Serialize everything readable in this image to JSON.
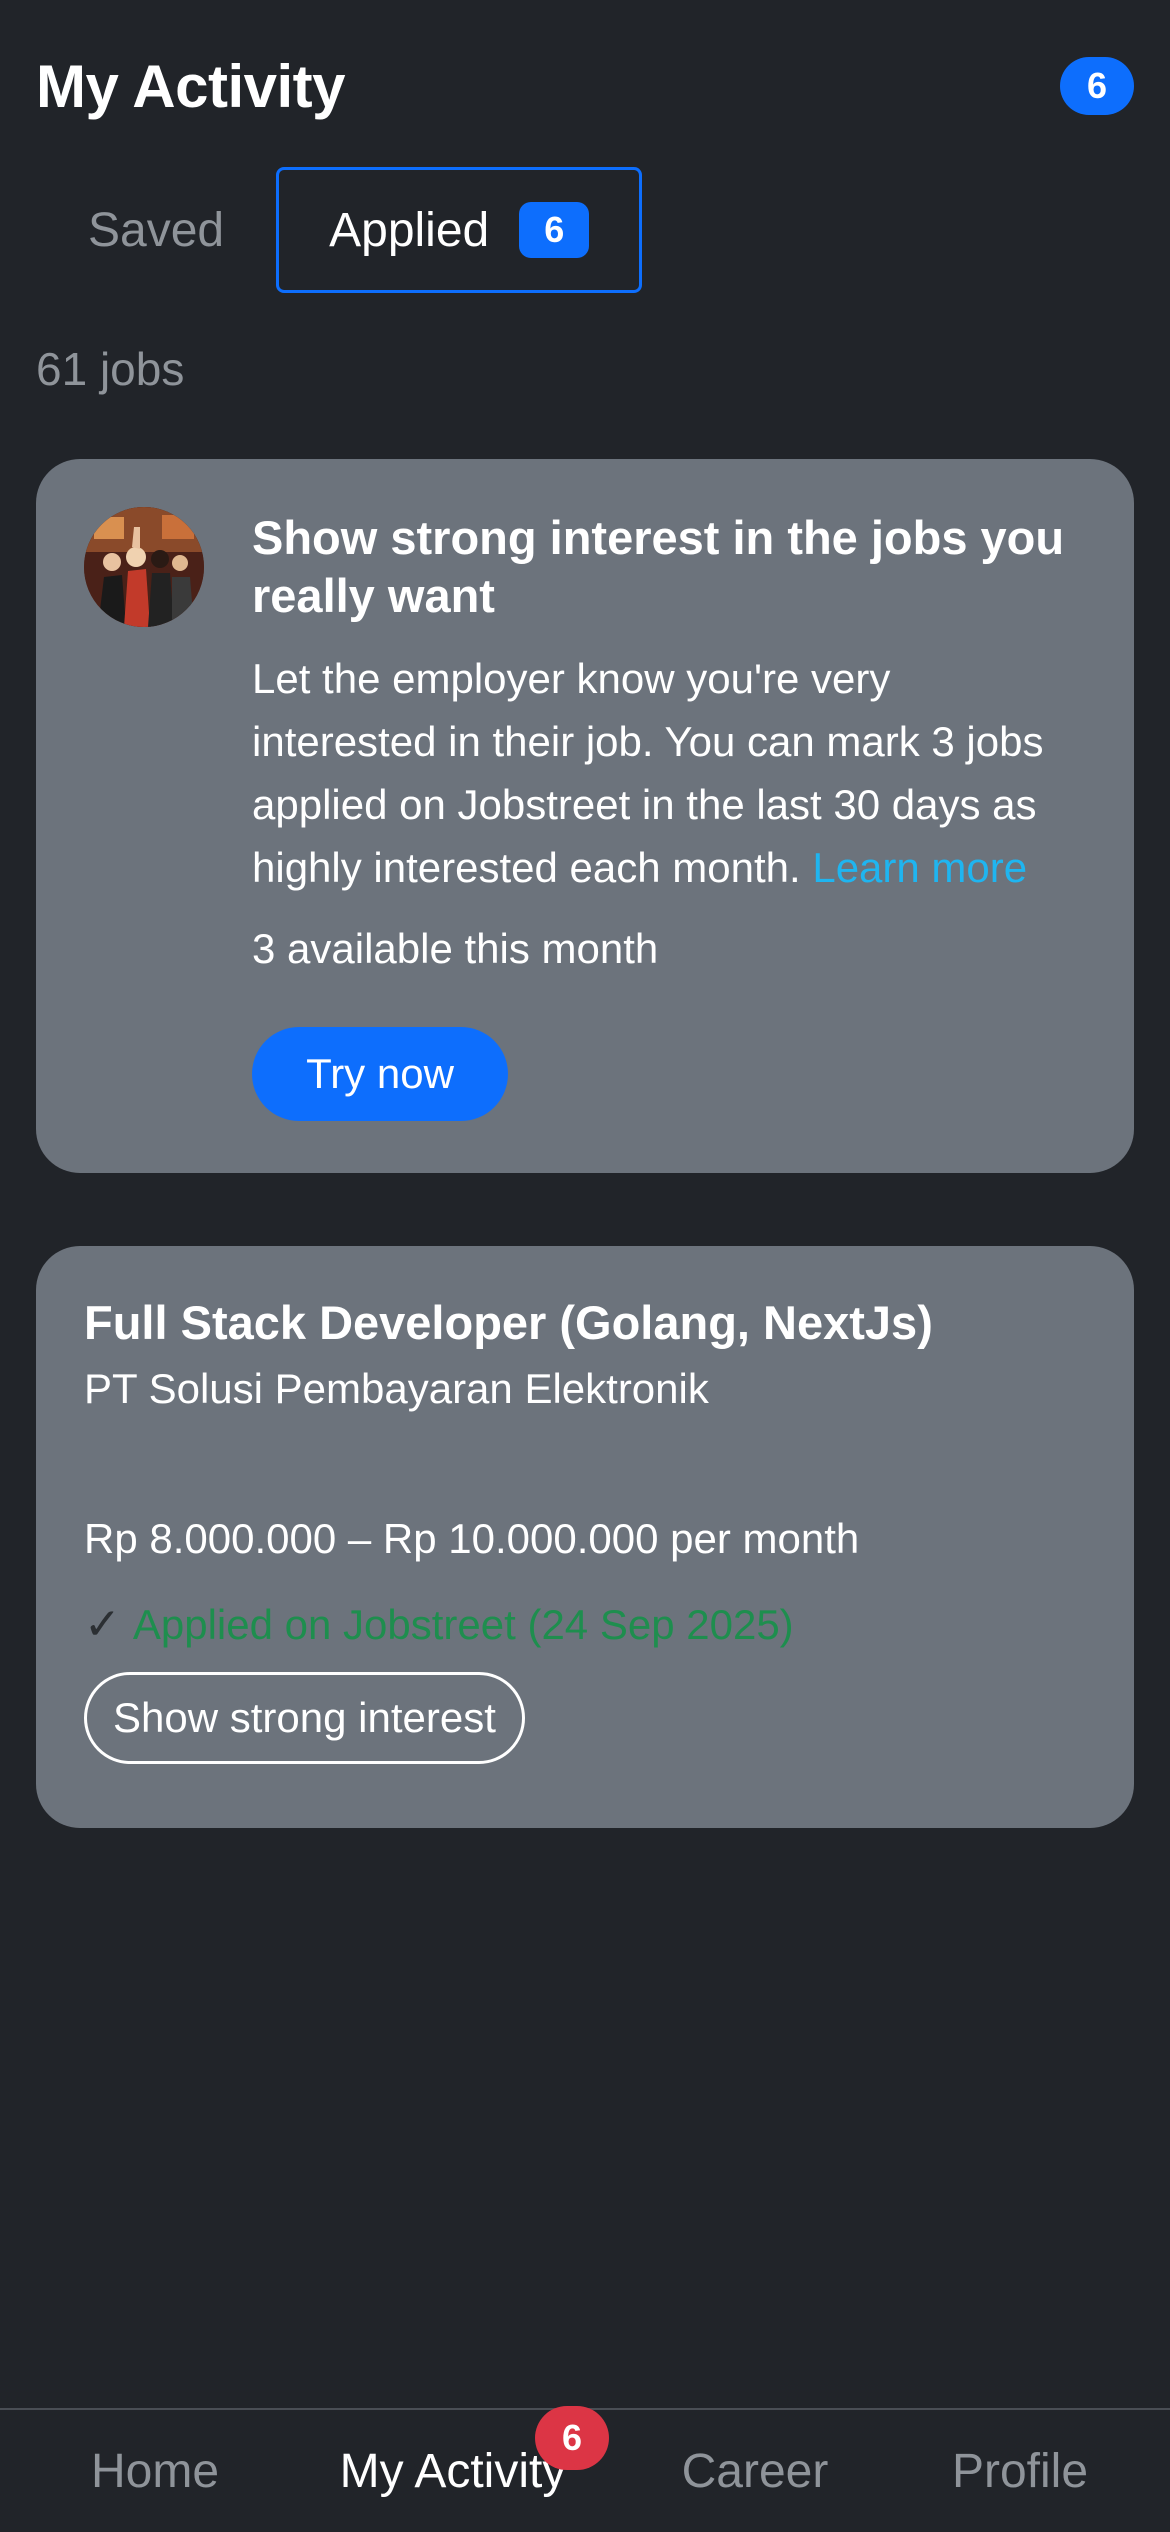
{
  "header": {
    "title": "My Activity",
    "badge": "6"
  },
  "tabs": {
    "saved_label": "Saved",
    "applied_label": "Applied",
    "applied_badge": "6"
  },
  "jobs_count": "61 jobs",
  "promo": {
    "title": "Show strong interest in the jobs you really want",
    "text": "Let the employer know you're very interested in their job. You can mark 3 jobs applied on Jobstreet in the last 30 days as highly interested each month.",
    "learn_more": "Learn more",
    "available": "3 available this month",
    "button": "Try now"
  },
  "job": {
    "title": "Full Stack Developer (Golang, NextJs)",
    "company": "PT Solusi Pembayaran Elektronik",
    "salary": "Rp 8.000.000 – Rp 10.000.000 per month",
    "check": "✓",
    "applied_status": "Applied on Jobstreet (24 Sep 2025)",
    "interest_button": "Show strong interest"
  },
  "bottom_nav": {
    "home": "Home",
    "activity": "My Activity",
    "activity_badge": "6",
    "career": "Career",
    "profile": "Profile"
  },
  "colors": {
    "background": "#212429",
    "card": "#6c737c",
    "accent": "#0d6efd",
    "link": "#1fb5f0",
    "success": "#1e8e4e",
    "nav_badge": "#dc3545"
  }
}
